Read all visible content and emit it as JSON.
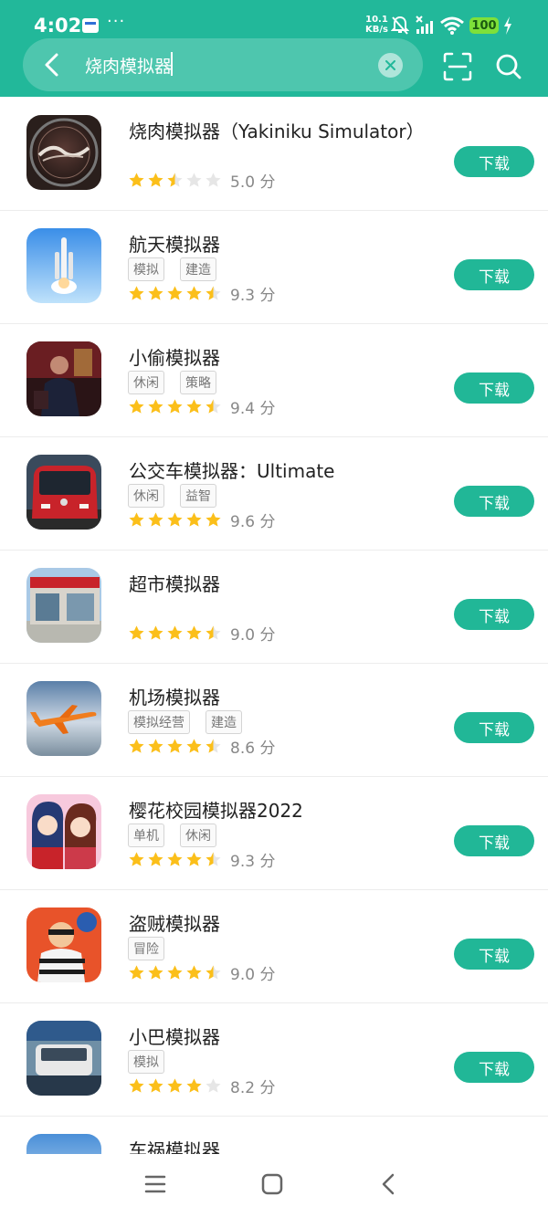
{
  "status_bar": {
    "time": "4:02",
    "net_speed_value": "10.1",
    "net_speed_unit": "KB/s",
    "battery": "100",
    "more": "···"
  },
  "search": {
    "query": "烧肉模拟器",
    "back_icon": "back-arrow-icon",
    "clear_icon": "clear-icon",
    "scan_icon": "scan-icon",
    "search_icon": "search-icon"
  },
  "colors": {
    "accent": "#22b89a",
    "star_full": "#fbbf1a",
    "star_empty": "#e6e6e6"
  },
  "download_label": "下载",
  "apps": [
    {
      "title": "烧肉模拟器（Yakiniku Simulator）",
      "tags": [],
      "stars": 2.5,
      "rating": "5.0 分"
    },
    {
      "title": "航天模拟器",
      "tags": [
        "模拟",
        "建造"
      ],
      "stars": 4.5,
      "rating": "9.3 分"
    },
    {
      "title": "小偷模拟器",
      "tags": [
        "休闲",
        "策略"
      ],
      "stars": 4.5,
      "rating": "9.4 分"
    },
    {
      "title": "公交车模拟器：Ultimate",
      "tags": [
        "休闲",
        "益智"
      ],
      "stars": 5,
      "rating": "9.6 分"
    },
    {
      "title": "超市模拟器",
      "tags": [],
      "stars": 4.5,
      "rating": "9.0 分"
    },
    {
      "title": "机场模拟器",
      "tags": [
        "模拟经营",
        "建造"
      ],
      "stars": 4.5,
      "rating": "8.6 分"
    },
    {
      "title": "樱花校园模拟器2022",
      "tags": [
        "单机",
        "休闲"
      ],
      "stars": 4.5,
      "rating": "9.3 分"
    },
    {
      "title": "盗贼模拟器",
      "tags": [
        "冒险"
      ],
      "stars": 4.5,
      "rating": "9.0 分"
    },
    {
      "title": "小巴模拟器",
      "tags": [
        "模拟"
      ],
      "stars": 4,
      "rating": "8.2 分"
    },
    {
      "title": "车祸模拟器",
      "tags": [],
      "stars": null,
      "rating": null
    }
  ],
  "nav": [
    "menu-icon",
    "home-icon",
    "back-icon"
  ]
}
